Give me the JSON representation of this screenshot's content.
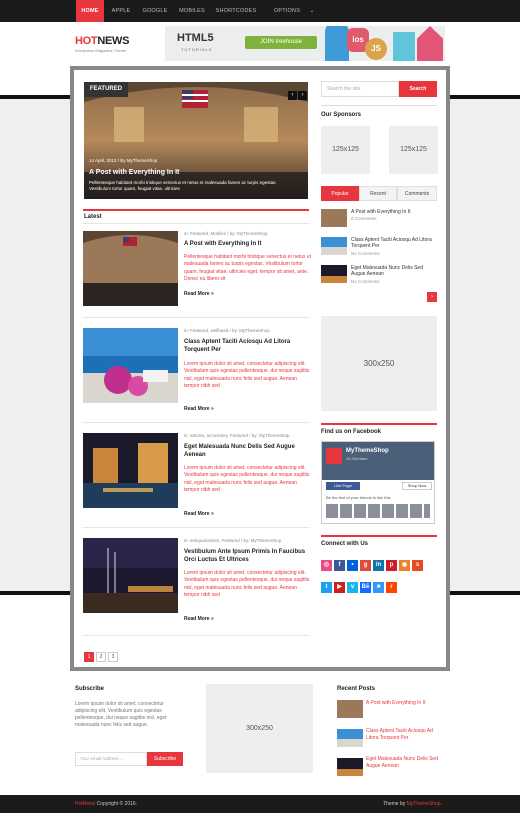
{
  "nav": {
    "items": [
      "HOME",
      "APPLE",
      "GOOGLE",
      "MOBILES",
      "SHORTCODES",
      "OPTIONS PANEL"
    ],
    "active_index": 0,
    "dropdown_indicator": "⌄"
  },
  "header": {
    "logo_hot": "HOT",
    "logo_news": "NEWS",
    "tagline": "Wordpress Magazine Theme",
    "banner": {
      "title": "HTML5",
      "subtitle": "TUTORIALS",
      "cta": "JOIN treehouse",
      "badges": [
        "ios",
        "JS"
      ]
    }
  },
  "slider": {
    "tag": "FEATURED",
    "meta": "14 April, 2013 / By MyThemeShop",
    "title": "A Post with Everything In It",
    "text": "Pellentesque habitant morbi tristique senectus et netus et malesuada fames ac turpis egestas. Vestibulum tortor quam, feugiat vitae, ultricies",
    "prev": "‹",
    "next": "›"
  },
  "latest": {
    "heading": "Latest",
    "read_more": "Read More »",
    "posts": [
      {
        "meta": "in: Featured, Mobiles / by: MyThemeShop",
        "title": "A Post with Everything In It",
        "text": "Pellentesque habitant morbi tristique senectus et netus et malesuada fames ac turpis egestas. Vestibulum tortor quam, feugiat vitae, ultricies eget, tempor sit amet, ante. Donec eu libero sit"
      },
      {
        "meta": "in: Featured, wellhead / by: MyThemeShop",
        "title": "Class Aptent Taciti Aciosqu Ad Litora Torquent Per",
        "text": "Lorem ipsum dolor sit amet, consectetur adipiscing elit. Vestibulum quis egestas pellentesque, dui neque sagittis nisl, eget malesuada nunc felis sed augue. Aenean tempor nibh sed"
      },
      {
        "meta": "in: articles, accesskey, Featured / by: MyThemeShop",
        "title": "Eget Malesuada Nunc Delis Sed Augue Aenean",
        "text": "Lorem ipsum dolor sit amet, consectetur adipiscing elit. Vestibulum quis egestas pellentesque, dui neque sagittis nisl, eget malesuada nunc felis sed augue. Aenean tempor nibh sed"
      },
      {
        "meta": "in: antiquarianism, Featured / by: MyThemeShop",
        "title": "Vestibulum Ante Ipsum Primis In Faucibus Orci Luctus Et Ultrices",
        "text": "Lorem ipsum dolor sit amet, consectetur adipiscing elit. Vestibulum quis egestas pellentesque, dui neque sagittis nisl, eget malesuada nunc felis sed augue. Aenean tempor nibh sed"
      }
    ]
  },
  "pagination": [
    "1",
    "2",
    "3"
  ],
  "sidebar": {
    "search_placeholder": "Search the site",
    "search_button": "Search",
    "sponsors_title": "Our Sponsors",
    "sponsor_ad": "125x125",
    "tabs": [
      "Popular",
      "Recent",
      "Comments"
    ],
    "popular": [
      {
        "title": "A Post with Everything In It",
        "count": "8 Comments"
      },
      {
        "title": "Class Aptent Taciti Aciosqu Ad Litora Torquent Per",
        "count": "No Comments"
      },
      {
        "title": "Eget Malesuada Nunc Delis Sed Augue Aenean",
        "count": "No Comments"
      }
    ],
    "next_arrow": "›",
    "ad_300": "300x250",
    "facebook_title": "Find us on Facebook",
    "facebook": {
      "page_name": "MyThemeShop",
      "likes": "43,344 likes",
      "like_button": "Like Page",
      "shop_button": "Shop Now",
      "friends_text": "Be the first of your friends to like this"
    },
    "connect_title": "Connect with Us",
    "social_icons": [
      {
        "name": "dribbble-icon",
        "glyph": "◎",
        "color": "#ea4c89"
      },
      {
        "name": "facebook-icon",
        "glyph": "f",
        "color": "#3b5998"
      },
      {
        "name": "flickr-icon",
        "glyph": "•",
        "color": "#0063dc"
      },
      {
        "name": "google-plus-icon",
        "glyph": "g",
        "color": "#dd4b39"
      },
      {
        "name": "linkedin-icon",
        "glyph": "in",
        "color": "#0e76a8"
      },
      {
        "name": "pinterest-icon",
        "glyph": "p",
        "color": "#cb2027"
      },
      {
        "name": "rss-icon",
        "glyph": "◉",
        "color": "#ee802f"
      },
      {
        "name": "stumbleupon-icon",
        "glyph": "s",
        "color": "#eb4924"
      },
      {
        "name": "twitter-icon",
        "glyph": "t",
        "color": "#1da1f2"
      },
      {
        "name": "youtube-icon",
        "glyph": "▶",
        "color": "#cd201f"
      },
      {
        "name": "vimeo-icon",
        "glyph": "v",
        "color": "#1ab7ea"
      },
      {
        "name": "behance-icon",
        "glyph": "Bē",
        "color": "#1769ff"
      },
      {
        "name": "delicious-icon",
        "glyph": "■",
        "color": "#3399ff"
      },
      {
        "name": "reddit-icon",
        "glyph": "r",
        "color": "#ff4500"
      }
    ]
  },
  "footer": {
    "subscribe_title": "Subscribe",
    "subscribe_text_pre": "Lorem ipsum dolor sit amet, consectetur adipiscing elit. Vestibulum quis egestas",
    "subscribe_text_post": "pellentesque, dui neque sagittis nisl, eget malesuada nunc felis sed augue.",
    "subscribe_placeholder": "Your email Address...",
    "subscribe_button": "Subscribe",
    "ad": "300x250",
    "recent_title": "Recent Posts",
    "recent": [
      "A Post with Everything In It",
      "Class Aptent Taciti Aciosqu Ad Litora Torquent Per",
      "Eget Malesuada Nunc Delis Sed Augue Aenean"
    ],
    "copyright_brand": "HotNews",
    "copyright_rest": " Copyright © 2016.",
    "theme_by": "Theme by ",
    "theme_by_brand": "MyThemeShop",
    "period": "."
  },
  "colors": {
    "accent": "#e8363e",
    "topbar": "#1b1b1b",
    "frame": "#888888"
  }
}
